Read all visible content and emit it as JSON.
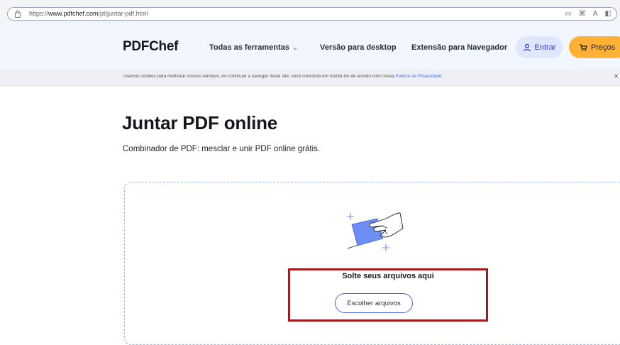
{
  "browser": {
    "url_prefix": "https://",
    "url_host": "www.pdfchef.com",
    "url_path": "/pt/juntar-pdf.html",
    "icons": [
      "reader-view-icon",
      "tab-grid-icon",
      "read-aloud-icon",
      "sidebar-icon"
    ]
  },
  "header": {
    "logo": "PDFChef",
    "nav": {
      "tools": "Todas as ferramentas",
      "desktop": "Versão para desktop",
      "extension": "Extensão para Navegador"
    },
    "login_label": "Entrar",
    "prices_label": "Preços"
  },
  "cookie_bar": {
    "text": "Usamos cookies para melhorar nossos serviços. Ao continuar a navegar neste site, você concorda em mantê-los de acordo com nossa ",
    "link": "Política de Privacidade",
    "end": "."
  },
  "main": {
    "title": "Juntar PDF online",
    "subtitle": "Combinador de PDF: mesclar e unir PDF online grátis.",
    "drop_text": "Solte seus arquivos aqui",
    "choose_button": "Escolher arquivos"
  },
  "colors": {
    "accent": "#4c62e0",
    "prices_button": "#ffb236",
    "header_bg": "#f2f6ff",
    "highlight": "#9e1c1c"
  }
}
